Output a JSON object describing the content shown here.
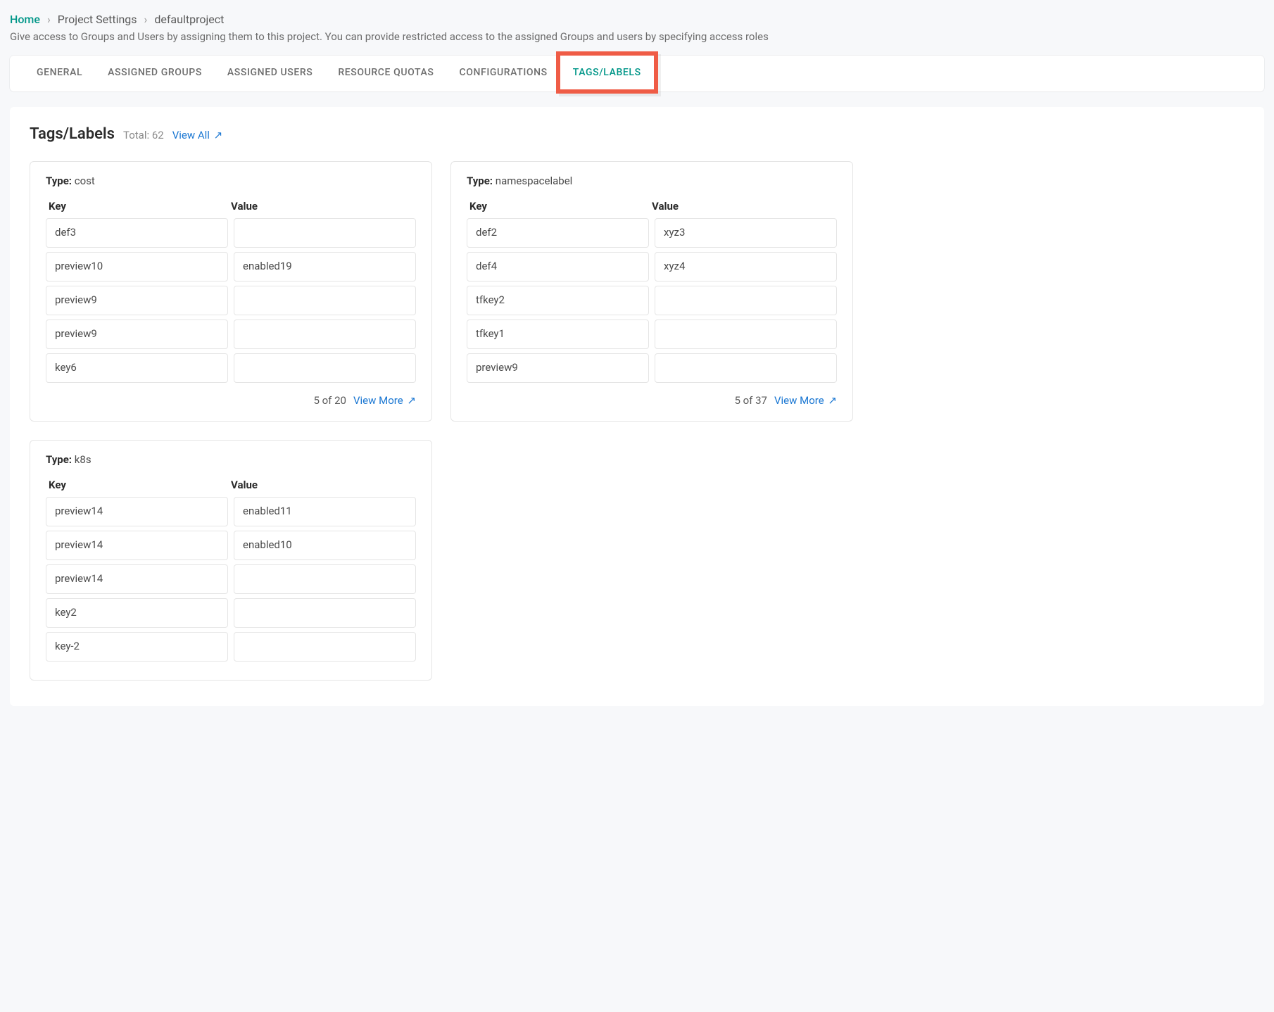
{
  "breadcrumb": {
    "home": "Home",
    "settings": "Project Settings",
    "project": "defaultproject",
    "sep": "›"
  },
  "subtitle": "Give access to Groups and Users by assigning them to this project. You can provide restricted access to the assigned Groups and users by specifying access roles",
  "tabs": {
    "general": "GENERAL",
    "assigned_groups": "ASSIGNED GROUPS",
    "assigned_users": "ASSIGNED USERS",
    "resource_quotas": "RESOURCE QUOTAS",
    "configurations": "CONFIGURATIONS",
    "tags_labels": "TAGS/LABELS"
  },
  "panel": {
    "title": "Tags/Labels",
    "total_label": "Total: 62",
    "view_all": "View All",
    "arrow": "↗"
  },
  "cards": {
    "cost": {
      "type_label": "Type:",
      "type_value": "cost",
      "key_header": "Key",
      "value_header": "Value",
      "rows": [
        {
          "key": "def3",
          "value": ""
        },
        {
          "key": "preview10",
          "value": "enabled19"
        },
        {
          "key": "preview9",
          "value": ""
        },
        {
          "key": "preview9",
          "value": ""
        },
        {
          "key": "key6",
          "value": ""
        }
      ],
      "count": "5 of 20",
      "view_more": "View More"
    },
    "namespacelabel": {
      "type_label": "Type:",
      "type_value": "namespacelabel",
      "key_header": "Key",
      "value_header": "Value",
      "rows": [
        {
          "key": "def2",
          "value": "xyz3"
        },
        {
          "key": "def4",
          "value": "xyz4"
        },
        {
          "key": "tfkey2",
          "value": ""
        },
        {
          "key": "tfkey1",
          "value": ""
        },
        {
          "key": "preview9",
          "value": ""
        }
      ],
      "count": "5 of 37",
      "view_more": "View More"
    },
    "k8s": {
      "type_label": "Type:",
      "type_value": "k8s",
      "key_header": "Key",
      "value_header": "Value",
      "rows": [
        {
          "key": "preview14",
          "value": "enabled11"
        },
        {
          "key": "preview14",
          "value": "enabled10"
        },
        {
          "key": "preview14",
          "value": ""
        },
        {
          "key": "key2",
          "value": ""
        },
        {
          "key": "key-2",
          "value": ""
        }
      ]
    }
  }
}
